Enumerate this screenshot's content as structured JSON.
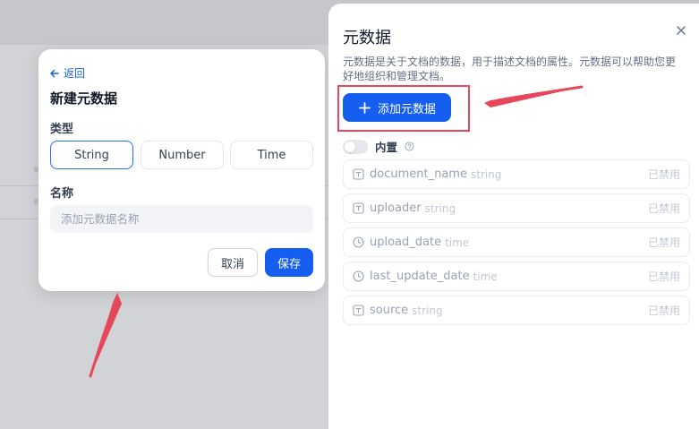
{
  "modal": {
    "back_label": "返回",
    "title": "新建元数据",
    "type_label": "类型",
    "types": [
      "String",
      "Number",
      "Time"
    ],
    "selected_type": "String",
    "name_label": "名称",
    "name_placeholder": "添加元数据名称",
    "cancel_label": "取消",
    "save_label": "保存"
  },
  "panel": {
    "title": "元数据",
    "description": "元数据是关于文档的数据，用于描述文档的属性。元数据可以帮助您更好地组织和管理文档。",
    "add_button_label": "添加元数据",
    "builtin_label": "内置",
    "builtin_enabled": false,
    "items": [
      {
        "name": "document_name",
        "type": "string",
        "status": "已禁用",
        "icon": "string-type-icon"
      },
      {
        "name": "uploader",
        "type": "string",
        "status": "已禁用",
        "icon": "string-type-icon"
      },
      {
        "name": "upload_date",
        "type": "time",
        "status": "已禁用",
        "icon": "clock-icon"
      },
      {
        "name": "last_update_date",
        "type": "time",
        "status": "已禁用",
        "icon": "clock-icon"
      },
      {
        "name": "source",
        "type": "string",
        "status": "已禁用",
        "icon": "string-type-icon"
      }
    ]
  },
  "colors": {
    "accent": "#155eef",
    "annotation": "#e6475a"
  }
}
